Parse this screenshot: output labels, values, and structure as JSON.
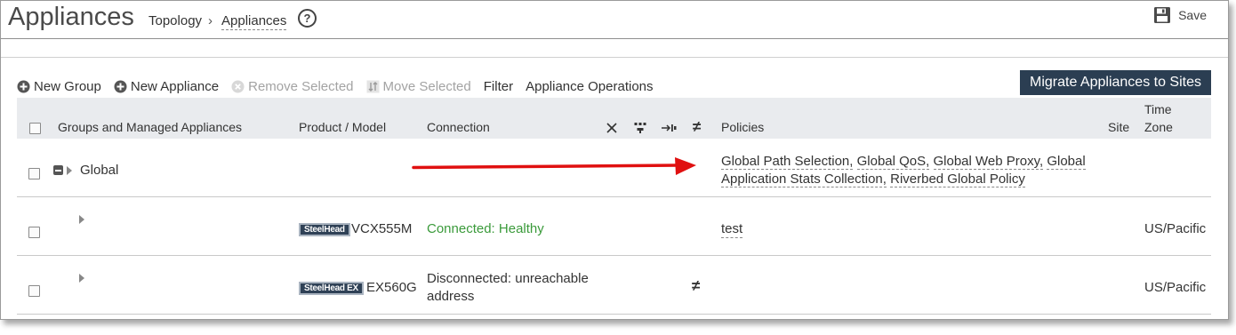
{
  "header": {
    "title": "Appliances",
    "breadcrumb": [
      "Topology",
      "›",
      "Appliances"
    ],
    "help_label": "?",
    "save_label": "Save"
  },
  "toolbar": {
    "new_group": "New Group",
    "new_appliance": "New Appliance",
    "remove_selected": "Remove Selected",
    "move_selected": "Move Selected",
    "filter": "Filter",
    "appliance_operations": "Appliance Operations",
    "migrate": "Migrate Appliances to Sites"
  },
  "table": {
    "headers": {
      "groups": "Groups and Managed Appliances",
      "product": "Product / Model",
      "connection": "Connection",
      "policies": "Policies",
      "site": "Site",
      "time_zone_1": "Time",
      "time_zone_2": "Zone"
    },
    "status_icons": [
      "wrench-icon",
      "network-icon",
      "push-icon",
      "not-equal-icon"
    ],
    "rows": [
      {
        "name": "Global",
        "policies_line1": [
          "Global Path Selection,",
          "Global QoS,",
          "Global Web Proxy,",
          "Global"
        ],
        "policies_line2": [
          "Application Stats Collection,",
          "Riverbed Global Policy"
        ]
      },
      {
        "badge": "SteelHead",
        "model": "VCX555M",
        "connection": "Connected: Healthy",
        "policy": "test",
        "timezone": "US/Pacific"
      },
      {
        "badge": "SteelHead EX",
        "model": "EX560G",
        "connection_1": "Disconnected: unreachable",
        "connection_2": "address",
        "mismatch": "≠",
        "timezone": "US/Pacific"
      }
    ]
  },
  "colors": {
    "migrate_bg": "#2b3e52",
    "header_bg": "#e9ebee",
    "healthy": "#3a9a3a",
    "arrow": "#e01010"
  }
}
